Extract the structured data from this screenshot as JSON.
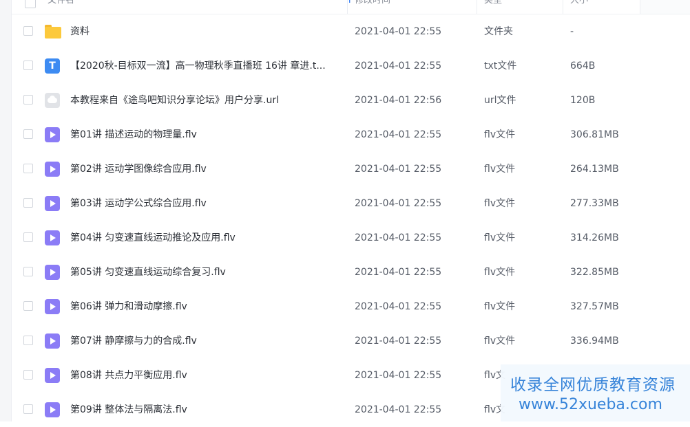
{
  "header": {
    "name_col": "文件名",
    "time_col": "修改时间",
    "type_col": "类型",
    "size_col": "大小",
    "sort_icon": "plus-icon"
  },
  "files": [
    {
      "name": "资料",
      "time": "2021-04-01 22:55",
      "type": "文件夹",
      "size": "-",
      "icon": "folder-icon"
    },
    {
      "name": "【2020秋-目标双一流】高一物理秋季直播班 16讲 章进.t...",
      "time": "2021-04-01 22:55",
      "type": "txt文件",
      "size": "664B",
      "icon": "text-file-icon"
    },
    {
      "name": "本教程来自《途鸟吧知识分享论坛》用户分享.url",
      "time": "2021-04-01 22:56",
      "type": "url文件",
      "size": "120B",
      "icon": "url-file-icon"
    },
    {
      "name": "第01讲 描述运动的物理量.flv",
      "time": "2021-04-01 22:55",
      "type": "flv文件",
      "size": "306.81MB",
      "icon": "video-file-icon"
    },
    {
      "name": "第02讲 运动学图像综合应用.flv",
      "time": "2021-04-01 22:55",
      "type": "flv文件",
      "size": "264.13MB",
      "icon": "video-file-icon"
    },
    {
      "name": "第03讲 运动学公式综合应用.flv",
      "time": "2021-04-01 22:55",
      "type": "flv文件",
      "size": "277.33MB",
      "icon": "video-file-icon"
    },
    {
      "name": "第04讲 匀变速直线运动推论及应用.flv",
      "time": "2021-04-01 22:55",
      "type": "flv文件",
      "size": "314.26MB",
      "icon": "video-file-icon"
    },
    {
      "name": "第05讲 匀变速直线运动综合复习.flv",
      "time": "2021-04-01 22:55",
      "type": "flv文件",
      "size": "322.85MB",
      "icon": "video-file-icon"
    },
    {
      "name": "第06讲 弹力和滑动摩擦.flv",
      "time": "2021-04-01 22:55",
      "type": "flv文件",
      "size": "327.57MB",
      "icon": "video-file-icon"
    },
    {
      "name": "第07讲 静摩擦与力的合成.flv",
      "time": "2021-04-01 22:55",
      "type": "flv文件",
      "size": "336.94MB",
      "icon": "video-file-icon"
    },
    {
      "name": "第08讲 共点力平衡应用.flv",
      "time": "2021-04-01 22:55",
      "type": "flv文",
      "size": "",
      "icon": "video-file-icon"
    },
    {
      "name": "第09讲 整体法与隔离法.flv",
      "time": "2021-04-01 22:55",
      "type": "flv文",
      "size": "",
      "icon": "video-file-icon"
    }
  ],
  "watermark": {
    "line1": "收录全网优质教育资源",
    "line2": "www.52xueba.com"
  },
  "colors": {
    "folder": "#fcc93c",
    "txt": "#3d8bf2",
    "url": "#e1e3e7",
    "video": "#8b7cf6",
    "watermark_text": "#2f7fd8"
  }
}
